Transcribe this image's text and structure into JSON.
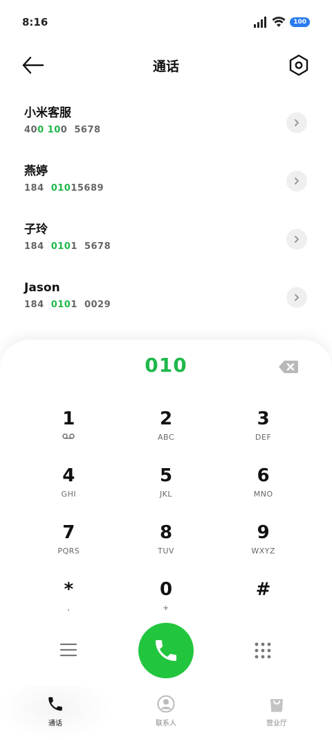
{
  "status_bar": {
    "time": "8:16",
    "battery": "100"
  },
  "header": {
    "title": "通话"
  },
  "matches": [
    {
      "name": "小米客服",
      "number_parts": [
        [
          "40",
          false
        ],
        [
          "0",
          true
        ],
        [
          " ",
          false
        ],
        [
          "10",
          true
        ],
        [
          "0  5678",
          false
        ]
      ]
    },
    {
      "name": "燕婷",
      "number_parts": [
        [
          "184  ",
          false
        ],
        [
          "010",
          true
        ],
        [
          "15689",
          false
        ]
      ]
    },
    {
      "name": "子玲",
      "number_parts": [
        [
          "184  ",
          false
        ],
        [
          "010",
          true
        ],
        [
          "1  5678",
          false
        ]
      ]
    },
    {
      "name": "Jason",
      "number_parts": [
        [
          "184  ",
          false
        ],
        [
          "010",
          true
        ],
        [
          "1  0029",
          false
        ]
      ]
    }
  ],
  "dialer": {
    "input": "010",
    "keys": [
      {
        "digit": "1",
        "letters": "voicemail",
        "icon": "voicemail-icon"
      },
      {
        "digit": "2",
        "letters": "ABC"
      },
      {
        "digit": "3",
        "letters": "DEF"
      },
      {
        "digit": "4",
        "letters": "GHI"
      },
      {
        "digit": "5",
        "letters": "JKL"
      },
      {
        "digit": "6",
        "letters": "MNO"
      },
      {
        "digit": "7",
        "letters": "PQRS"
      },
      {
        "digit": "8",
        "letters": "TUV"
      },
      {
        "digit": "9",
        "letters": "WXYZ"
      },
      {
        "digit": "*",
        "letters": ","
      },
      {
        "digit": "0",
        "letters": "+"
      },
      {
        "digit": "#",
        "letters": ""
      }
    ]
  },
  "nav": {
    "items": [
      {
        "label": "通话",
        "icon": "phone-icon",
        "active": true
      },
      {
        "label": "联系人",
        "icon": "contact-icon",
        "active": false
      },
      {
        "label": "营业厅",
        "icon": "store-bag-icon",
        "active": false
      }
    ]
  },
  "colors": {
    "accent": "#1fb84a",
    "call": "#22c63e",
    "battery": "#2a7bf0"
  }
}
